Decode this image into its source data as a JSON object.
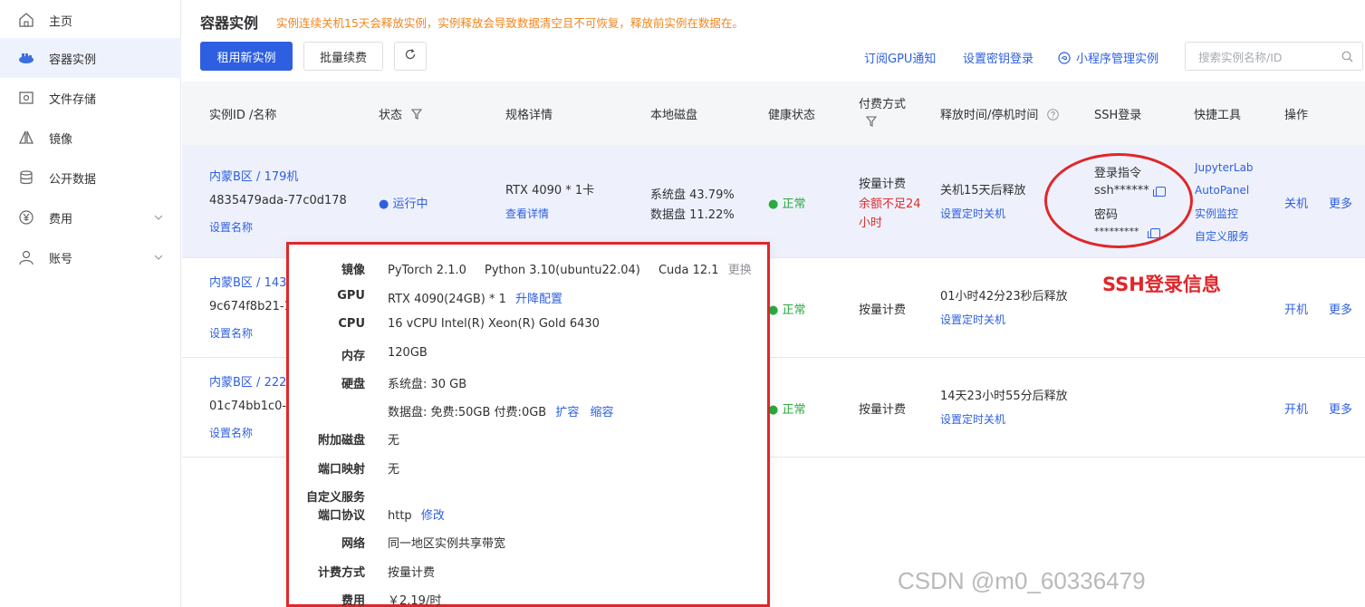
{
  "sidebar": {
    "items": [
      {
        "label": "主页",
        "icon": "home-icon"
      },
      {
        "label": "容器实例",
        "icon": "container-icon"
      },
      {
        "label": "文件存储",
        "icon": "storage-icon"
      },
      {
        "label": "镜像",
        "icon": "mirror-icon"
      },
      {
        "label": "公开数据",
        "icon": "database-icon"
      },
      {
        "label": "费用",
        "icon": "yen-icon"
      },
      {
        "label": "账号",
        "icon": "user-icon"
      }
    ]
  },
  "header": {
    "title": "容器实例",
    "warning": "实例连续关机15天会释放实例，实例释放会导致数据清空且不可恢复，释放前实例在数据在。"
  },
  "toolbar": {
    "rent_label": "租用新实例",
    "renew_label": "批量续费",
    "subscribe_label": "订阅GPU通知",
    "key_login_label": "设置密钥登录",
    "miniapp_label": "小程序管理实例",
    "search_placeholder": "搜索实例名称/ID"
  },
  "table": {
    "headers": {
      "id": "实例ID /名称",
      "status": "状态",
      "spec": "规格详情",
      "disk": "本地磁盘",
      "health": "健康状态",
      "billing": "付费方式",
      "release": "释放时间/停机时间",
      "ssh": "SSH登录",
      "tools": "快捷工具",
      "ops": "操作"
    },
    "rows": [
      {
        "region": "内蒙B区 / 179机",
        "id": "4835479ada-77c0d178",
        "set_name": "设置名称",
        "status": "运行中",
        "spec": "RTX 4090 * 1卡",
        "spec_detail": "查看详情",
        "sys_disk": "系统盘 43.79%",
        "data_disk": "数据盘 11.22%",
        "health": "正常",
        "billing": "按量计费",
        "billing_warn": "余额不足24小时",
        "release": "关机15天后释放",
        "release_link": "设置定时关机",
        "ssh_cmd_label": "登录指令",
        "ssh_cmd": "ssh******",
        "ssh_pwd_label": "密码",
        "ssh_pwd": "*********",
        "tools": [
          "JupyterLab",
          "AutoPanel",
          "实例监控",
          "自定义服务"
        ],
        "op": "关机",
        "more": "更多"
      },
      {
        "region": "内蒙B区 / 143",
        "id": "9c674f8b21-1",
        "set_name": "设置名称",
        "health": "正常",
        "billing": "按量计费",
        "release": "01小时42分23秒后释放",
        "release_link": "设置定时关机",
        "op": "开机",
        "more": "更多"
      },
      {
        "region": "内蒙B区 / 222",
        "id": "01c74bb1c0-9",
        "set_name": "设置名称",
        "health": "正常",
        "billing": "按量计费",
        "release": "14天23小时55分后释放",
        "release_link": "设置定时关机",
        "op": "开机",
        "more": "更多"
      }
    ]
  },
  "popup": {
    "image_label": "镜像",
    "image_pytorch": "PyTorch  2.1.0",
    "image_python": "Python  3.10(ubuntu22.04)",
    "image_cuda": "Cuda  12.1",
    "image_change": "更换",
    "gpu_label": "GPU",
    "gpu_value": "RTX 4090(24GB) * 1",
    "gpu_link": "升降配置",
    "cpu_label": "CPU",
    "cpu_value": "16 vCPU Intel(R) Xeon(R) Gold 6430",
    "mem_label": "内存",
    "mem_value": "120GB",
    "disk_label": "硬盘",
    "disk_sys": "系统盘:   30 GB",
    "disk_data": "数据盘:  免费:50GB   付费:0GB",
    "disk_expand": "扩容",
    "disk_shrink": "缩容",
    "extra_disk_label": "附加磁盘",
    "extra_disk_value": "无",
    "port_map_label": "端口映射",
    "port_map_value": "无",
    "custom_service_label": "自定义服务",
    "port_proto_label": "端口协议",
    "port_proto_value": "http",
    "port_proto_edit": "修改",
    "network_label": "网络",
    "network_value": "同一地区实例共享带宽",
    "billing_label": "计费方式",
    "billing_value": "按量计费",
    "fee_label": "费用",
    "fee_value": "￥2.19/时"
  },
  "annotation": {
    "ssh_label": "SSH登录信息"
  },
  "watermark": "CSDN @m0_60336479",
  "colors": {
    "accent": "#2d5fe0",
    "warning": "#f0861e",
    "healthy": "#2aaa3f",
    "danger": "#e02d2d",
    "annotation": "#e0262a"
  }
}
